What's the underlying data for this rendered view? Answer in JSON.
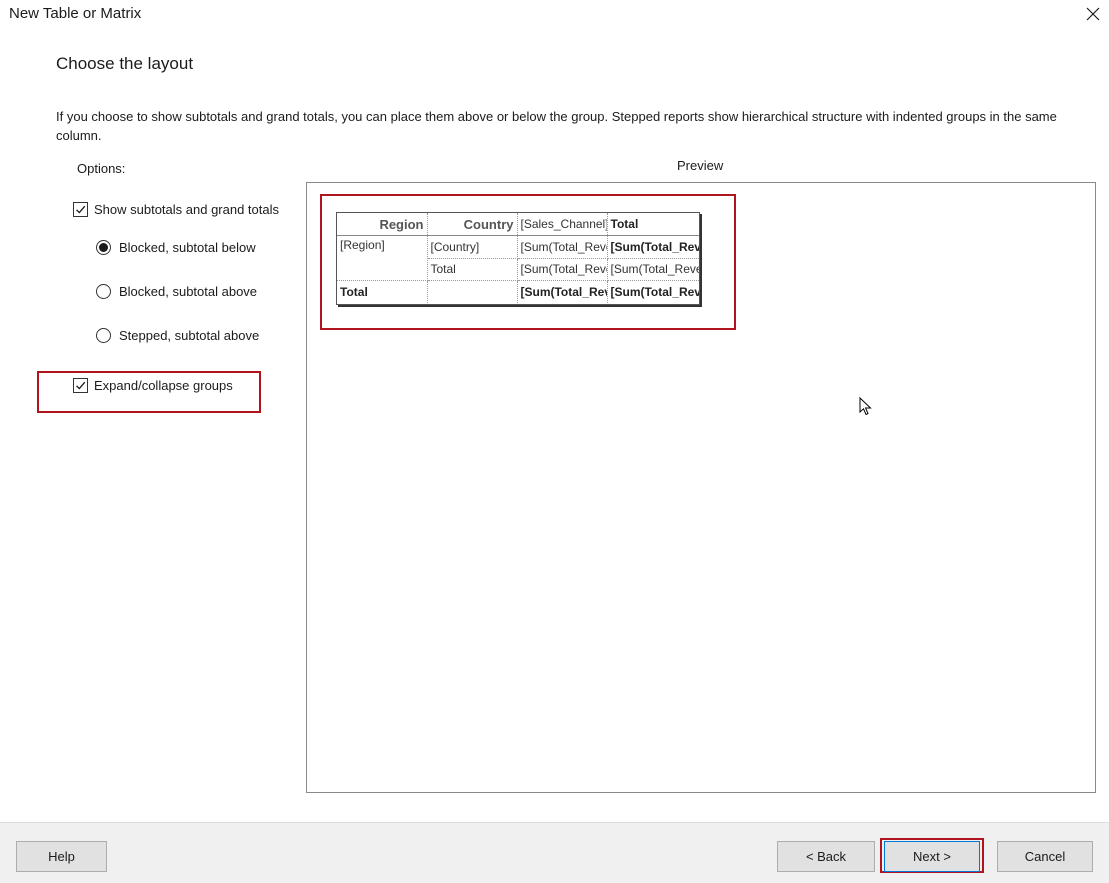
{
  "window": {
    "title": "New Table or Matrix",
    "close_icon": "close-icon"
  },
  "page": {
    "title": "Choose the layout",
    "description": "If you choose to show subtotals and grand totals, you can place them above or below the group. Stepped reports show hierarchical structure with indented groups in the same column."
  },
  "options": {
    "label": "Options:",
    "show_subtotals": {
      "label": "Show subtotals and grand totals",
      "checked": true
    },
    "layouts": [
      {
        "label": "Blocked, subtotal below",
        "selected": true
      },
      {
        "label": "Blocked, subtotal above",
        "selected": false
      },
      {
        "label": "Stepped, subtotal above",
        "selected": false
      }
    ],
    "expand_collapse": {
      "label": "Expand/collapse groups",
      "checked": true
    }
  },
  "preview": {
    "label": "Preview",
    "table": {
      "header": [
        "Region",
        "Country",
        "[Sales_Channel]",
        "Total"
      ],
      "rows": [
        [
          "[Region]",
          "[Country]",
          "[Sum(Total_Revenue)]",
          "[Sum(Total_Revenue)]"
        ],
        [
          "",
          "Total",
          "[Sum(Total_Revenue)]",
          "[Sum(Total_Revenue)]"
        ],
        [
          "Total",
          "",
          "[Sum(Total_Revenue)]",
          "[Sum(Total_Revenue)]"
        ]
      ]
    }
  },
  "footer": {
    "help": "Help",
    "back": "< Back",
    "next": "Next >",
    "cancel": "Cancel"
  },
  "colors": {
    "highlight": "#b0141c",
    "footer_bg": "#f0f0f0",
    "button_bg": "#e1e1e1",
    "focus_border": "#0078d7"
  }
}
